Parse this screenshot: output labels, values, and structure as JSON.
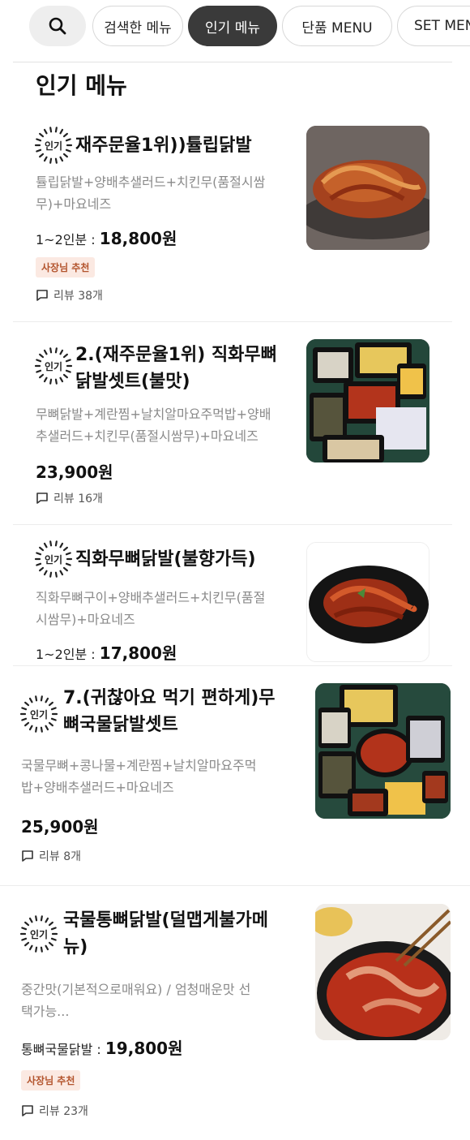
{
  "tabs": {
    "search_icon": "search-icon",
    "chips": [
      {
        "label": "검색한 메뉴",
        "active": false
      },
      {
        "label": "인기 메뉴",
        "active": true
      },
      {
        "label": "단품 MENU",
        "active": false
      },
      {
        "label": "SET MENU",
        "active": false
      }
    ]
  },
  "section": {
    "title": "인기 메뉴"
  },
  "items": [
    {
      "badge": "인기",
      "title_lines": [
        "재주문율1위))튤립닭발"
      ],
      "desc_lines": [
        "튤립닭발+양배추샐러드+치킨무(품절시쌈",
        "무)+마요네즈"
      ],
      "price_prefix": "1~2인분 : ",
      "price": "18,800원",
      "recommend": "사장님 추천",
      "review": "리뷰 38개"
    },
    {
      "badge": "인기",
      "title_lines": [
        "2.(재주문율1위) 직화무뼈",
        "닭발셋트(불맛)"
      ],
      "desc_lines": [
        "무뼈닭발+계란찜+날치알마요주먹밥+양배",
        "추샐러드+치킨무(품절시쌈무)+마요네즈"
      ],
      "price_prefix": "",
      "price": "23,900원",
      "recommend": "",
      "review": "리뷰 16개"
    },
    {
      "badge": "인기",
      "title_lines": [
        "직화무뼈닭발(불향가득)"
      ],
      "desc_lines": [
        "직화무뼈구이+양배추샐러드+치킨무(품절",
        "시쌈무)+마요네즈"
      ],
      "price_prefix": "1~2인분 : ",
      "price": "17,800원",
      "recommend": "",
      "review": ""
    },
    {
      "badge": "인기",
      "title_lines": [
        "7.(귀찮아요 먹기 편하게)무",
        "뼈국물닭발셋트"
      ],
      "desc_lines": [
        "국물무뼈+콩나물+계란찜+날치알마요주먹",
        "밥+양배추샐러드+마요네즈"
      ],
      "price_prefix": "",
      "price": "25,900원",
      "recommend": "",
      "review": "리뷰 8개"
    },
    {
      "badge": "인기",
      "title_lines": [
        "국물통뼈닭발(덜맵게불가메",
        "뉴)"
      ],
      "desc_lines": [
        "중간맛(기본적으로매워요) / 엄청매운맛 선",
        "택가능..."
      ],
      "price_prefix": "통뼈국물닭발 : ",
      "price": "19,800원",
      "recommend": "사장님 추천",
      "review": "리뷰 23개"
    }
  ],
  "colors": {
    "accent_dark": "#3a3a3a",
    "recommend_bg": "#fbe9e2",
    "recommend_text": "#b3542d"
  }
}
